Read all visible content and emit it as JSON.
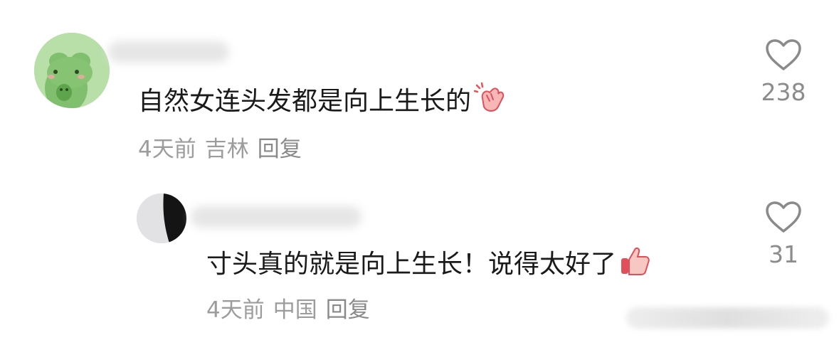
{
  "comments": [
    {
      "text": "自然女连头发都是向上生长的",
      "emoji": "waving-hand-emoji",
      "time": "4天前",
      "location": "吉林",
      "reply_label": "回复",
      "likes": "238"
    },
    {
      "text": "寸头真的就是向上生长！说得太好了",
      "emoji": "thumbs-up-emoji",
      "time": "4天前",
      "location": "中国",
      "reply_label": "回复",
      "likes": "31"
    }
  ],
  "colors": {
    "text": "#1a1a1a",
    "meta": "#9c9c9c",
    "avatar1_bg": "#a8d49a",
    "emoji_red": "#e8505a"
  }
}
